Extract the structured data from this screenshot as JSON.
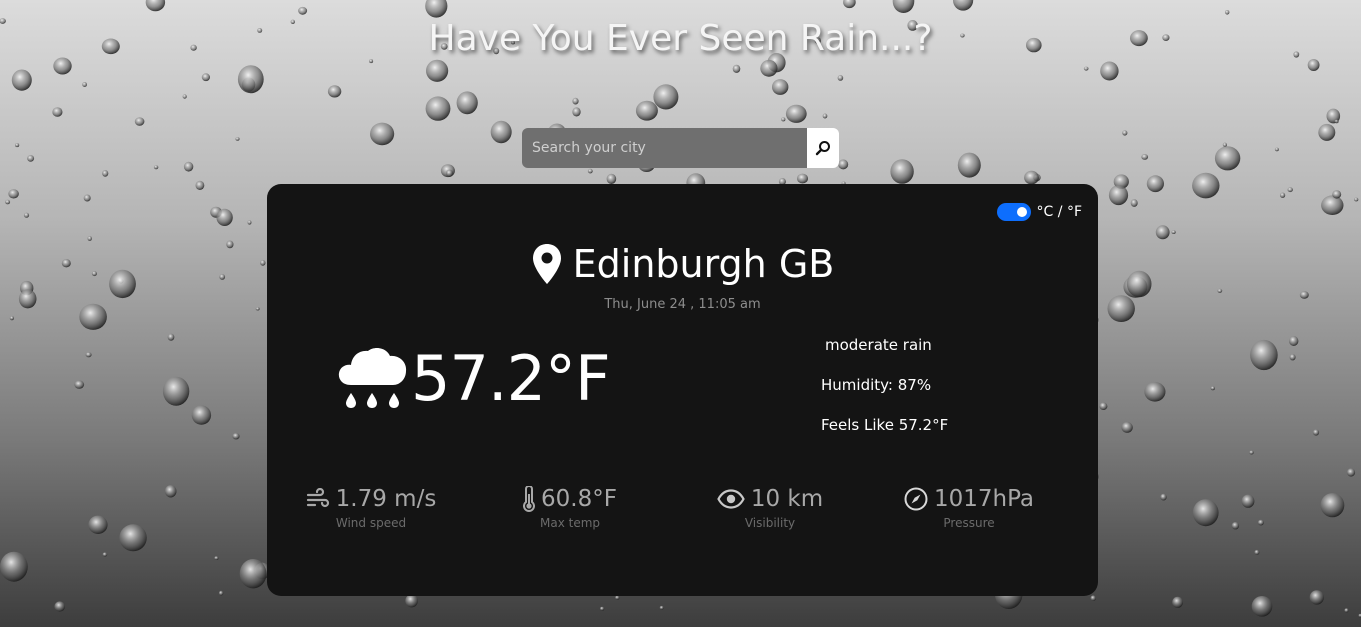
{
  "header": {
    "title": "Have You Ever Seen Rain...?"
  },
  "search": {
    "placeholder": "Search your city",
    "value": ""
  },
  "units": {
    "toggle_label": "°C / °F",
    "fahrenheit_enabled": true
  },
  "location": {
    "city": "Edinburgh GB",
    "datetime": "Thu, June 24 , 11:05 am"
  },
  "current": {
    "icon": "rain-cloud-icon",
    "temperature": "57.2°F",
    "description": "moderate rain",
    "humidity": "Humidity: 87%",
    "feels_like": "Feels Like 57.2°F"
  },
  "stats": [
    {
      "icon": "wind-icon",
      "value": "1.79 m/s",
      "label": "Wind speed"
    },
    {
      "icon": "thermometer-icon",
      "value": "60.8°F",
      "label": "Max temp"
    },
    {
      "icon": "eye-icon",
      "value": "10 km",
      "label": "Visibility"
    },
    {
      "icon": "compass-icon",
      "value": "1017hPa",
      "label": "Pressure"
    }
  ],
  "colors": {
    "card": "#141414",
    "toggle": "#0d6efd",
    "muted_text": "#8d8d8d"
  }
}
